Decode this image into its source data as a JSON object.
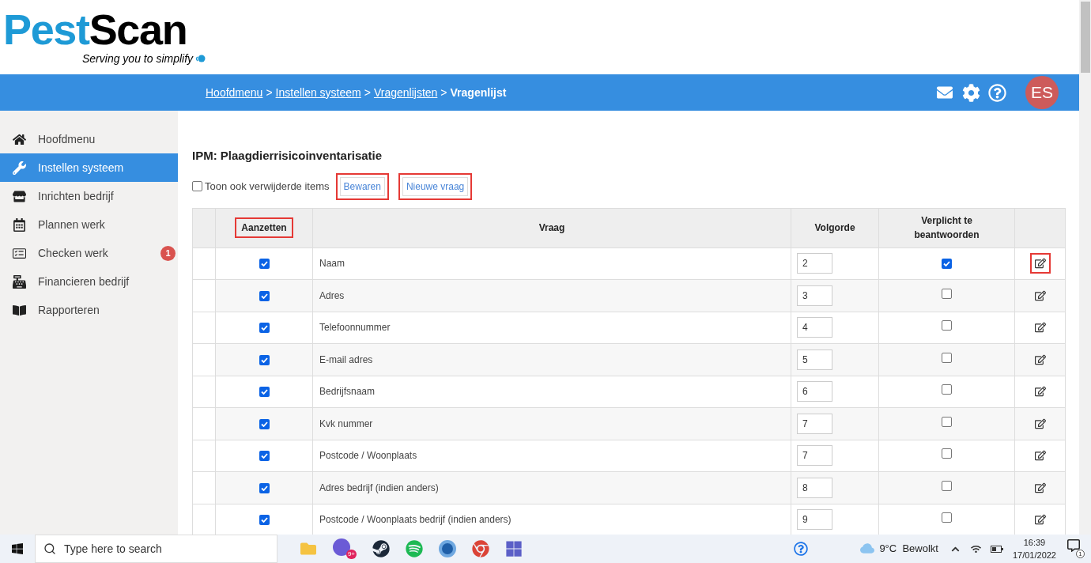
{
  "logo": {
    "brand_part1": "Pest",
    "brand_part2": "Scan",
    "tagline": "Serving you to simplify"
  },
  "breadcrumb": [
    {
      "label": "Hoofdmenu",
      "link": true
    },
    {
      "label": "Instellen systeem",
      "link": true
    },
    {
      "label": "Vragenlijsten",
      "link": true
    },
    {
      "label": "Vragenlijst",
      "link": false
    }
  ],
  "separator": ">",
  "user": {
    "initials": "ES"
  },
  "sidebar": {
    "items": [
      {
        "label": "Hoofdmenu",
        "selected": false
      },
      {
        "label": "Instellen systeem",
        "selected": true
      },
      {
        "label": "Inrichten bedrijf",
        "selected": false
      },
      {
        "label": "Plannen werk",
        "selected": false
      },
      {
        "label": "Checken werk",
        "selected": false,
        "badge": "1"
      },
      {
        "label": "Financieren bedrijf",
        "selected": false
      },
      {
        "label": "Rapporteren",
        "selected": false
      }
    ]
  },
  "page": {
    "title": "IPM: Plaagdierrisicoinventarisatie",
    "show_deleted": {
      "label": "Toon ook verwijderde items",
      "checked": false
    },
    "buttons": [
      {
        "label": "Bewaren",
        "highlighted": true
      },
      {
        "label": "Nieuwe vraag",
        "highlighted": true
      }
    ]
  },
  "table": {
    "columns": [
      {
        "label": "Aanzetten",
        "highlighted": true
      },
      {
        "label": "Vraag",
        "highlighted": false
      },
      {
        "label": "Volgorde",
        "highlighted": false
      },
      {
        "label": "Verplicht te beantwoorden",
        "highlighted": false
      }
    ],
    "rows": [
      {
        "enabled": true,
        "question": "Naam",
        "order": "2",
        "required": true,
        "highlighted": true
      },
      {
        "enabled": true,
        "question": "Adres",
        "order": "3",
        "required": false,
        "highlighted": false
      },
      {
        "enabled": true,
        "question": "Telefoonnummer",
        "order": "4",
        "required": false,
        "highlighted": false
      },
      {
        "enabled": true,
        "question": "E-mail adres",
        "order": "5",
        "required": false,
        "highlighted": false
      },
      {
        "enabled": true,
        "question": "Bedrijfsnaam",
        "order": "6",
        "required": false,
        "highlighted": false
      },
      {
        "enabled": true,
        "question": "Kvk nummer",
        "order": "7",
        "required": false,
        "highlighted": false
      },
      {
        "enabled": true,
        "question": "Postcode / Woonplaats",
        "order": "7",
        "required": false,
        "highlighted": false
      },
      {
        "enabled": true,
        "question": "Adres bedrijf (indien anders)",
        "order": "8",
        "required": false,
        "highlighted": false
      },
      {
        "enabled": true,
        "question": "Postcode / Woonplaats bedrijf (indien anders)",
        "order": "9",
        "required": false,
        "highlighted": false
      }
    ]
  },
  "taskbar": {
    "search_placeholder": "Type here to search",
    "app_badge": "9+",
    "weather": "9°C  Bewolkt",
    "time": "16:39",
    "date": "17/01/2022",
    "notifications": "1"
  }
}
